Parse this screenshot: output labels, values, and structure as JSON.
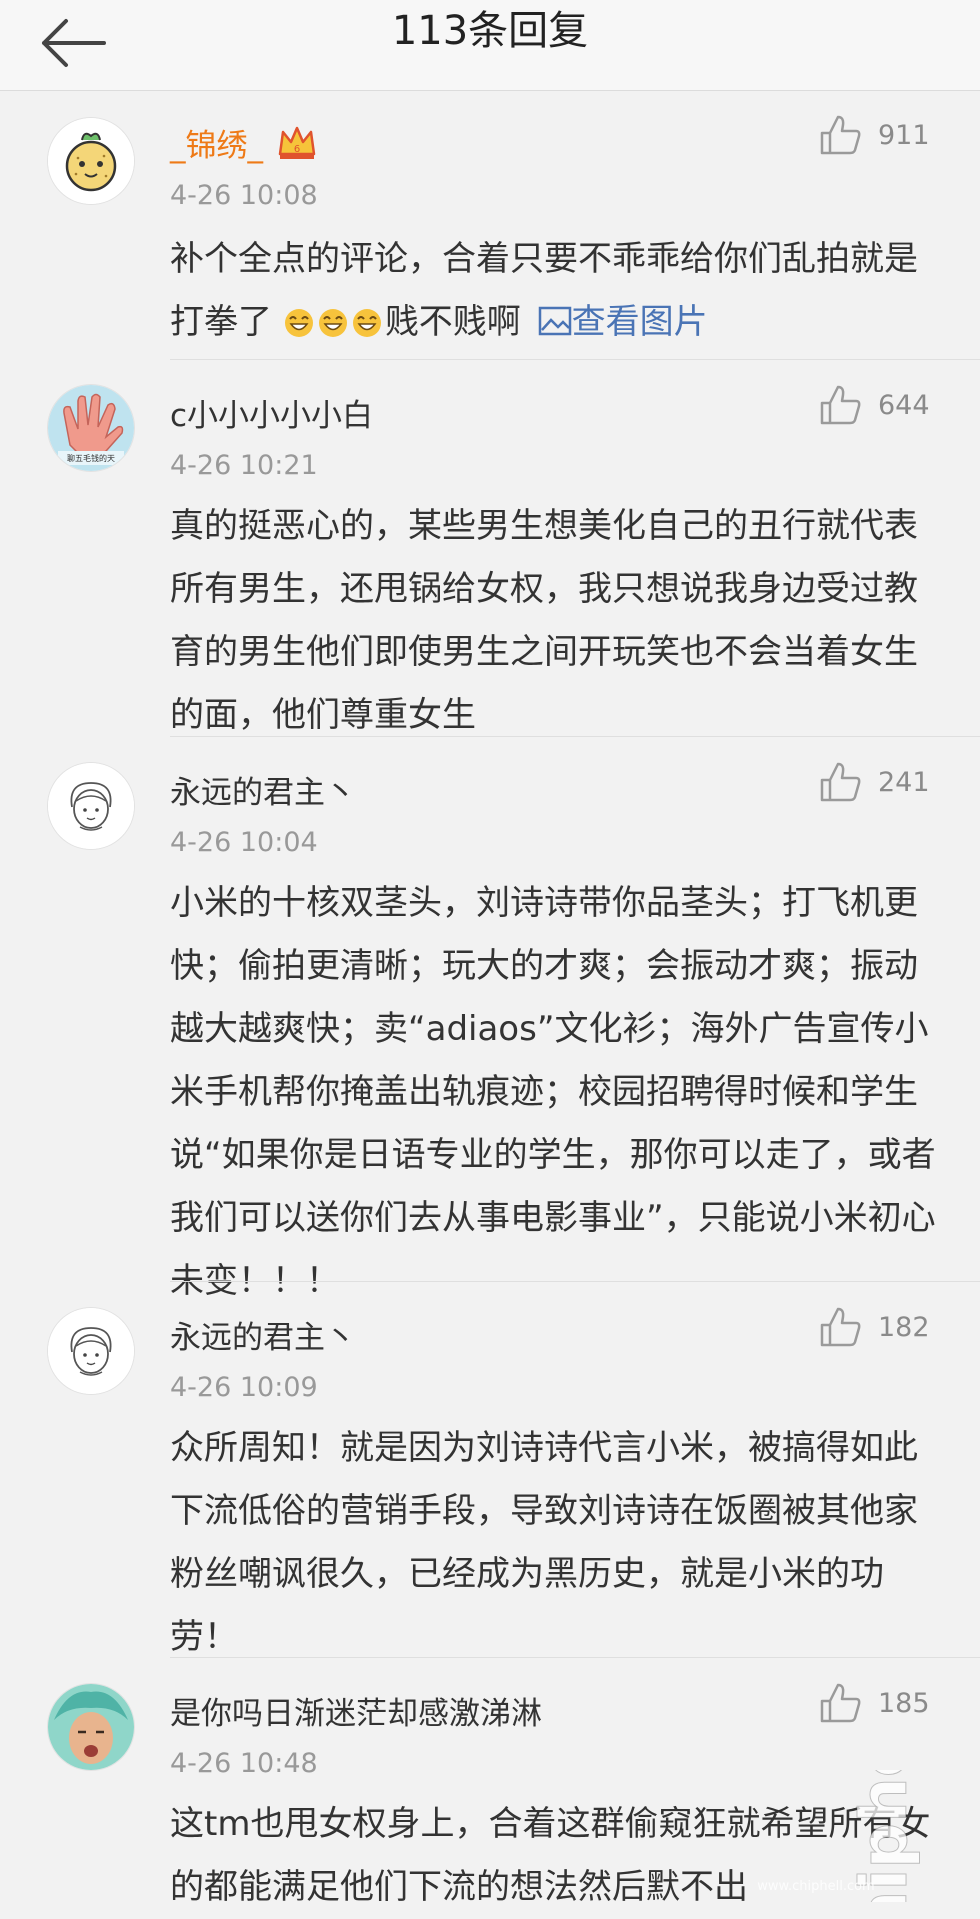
{
  "header": {
    "title": "113条回复"
  },
  "comments": [
    {
      "name": "_锦绣_",
      "time": "4-26 10:08",
      "likes": "911",
      "text": "补个全点的评论，合着只要不乖乖给你们乱拍就是打拳了",
      "text_after": "贱不贱啊",
      "view_image": "查看图片",
      "emoji_icon": "grinning-emoji-icon"
    },
    {
      "name": "c小小小小小白",
      "time": "4-26 10:21",
      "likes": "644",
      "avatar_caption": "聊五毛钱的天",
      "text": "真的挺恶心的，某些男生想美化自己的丑行就代表所有男生，还甩锅给女权，我只想说我身边受过教育的男生他们即使男生之间开玩笑也不会当着女生的面，他们尊重女生"
    },
    {
      "name": "永远的君主丶",
      "time": "4-26 10:04",
      "likes": "241",
      "text": "小米的十核双茎头，刘诗诗带你品茎头；打飞机更快；偷拍更清晰；玩大的才爽；会振动才爽；振动越大越爽快；卖“adiaos”文化衫；海外广告宣传小米手机帮你掩盖出轨痕迹；校园招聘得时候和学生说“如果你是日语专业的学生，那你可以走了，或者我们可以送你们去从事电影事业”，只能说小米初心未变！！！"
    },
    {
      "name": "永远的君主丶",
      "time": "4-26 10:09",
      "likes": "182",
      "text": "众所周知！就是因为刘诗诗代言小米，被搞得如此下流低俗的营销手段，导致刘诗诗在饭圈被其他家粉丝嘲讽很久，已经成为黑历史，就是小米的功劳！"
    },
    {
      "name": "是你吗日渐迷茫却感激涕淋",
      "time": "4-26 10:48",
      "likes": "185",
      "text": "这tm也甩女权身上，合着这群偷窥狂就希望所有女的都能满足他们下流的想法然后默不出"
    }
  ],
  "watermark": {
    "logo": "chiphell",
    "url": "www.chiphell.com"
  },
  "colors": {
    "vip_name": "#ee7a17",
    "link": "#4a74b5",
    "meta": "#999999"
  }
}
